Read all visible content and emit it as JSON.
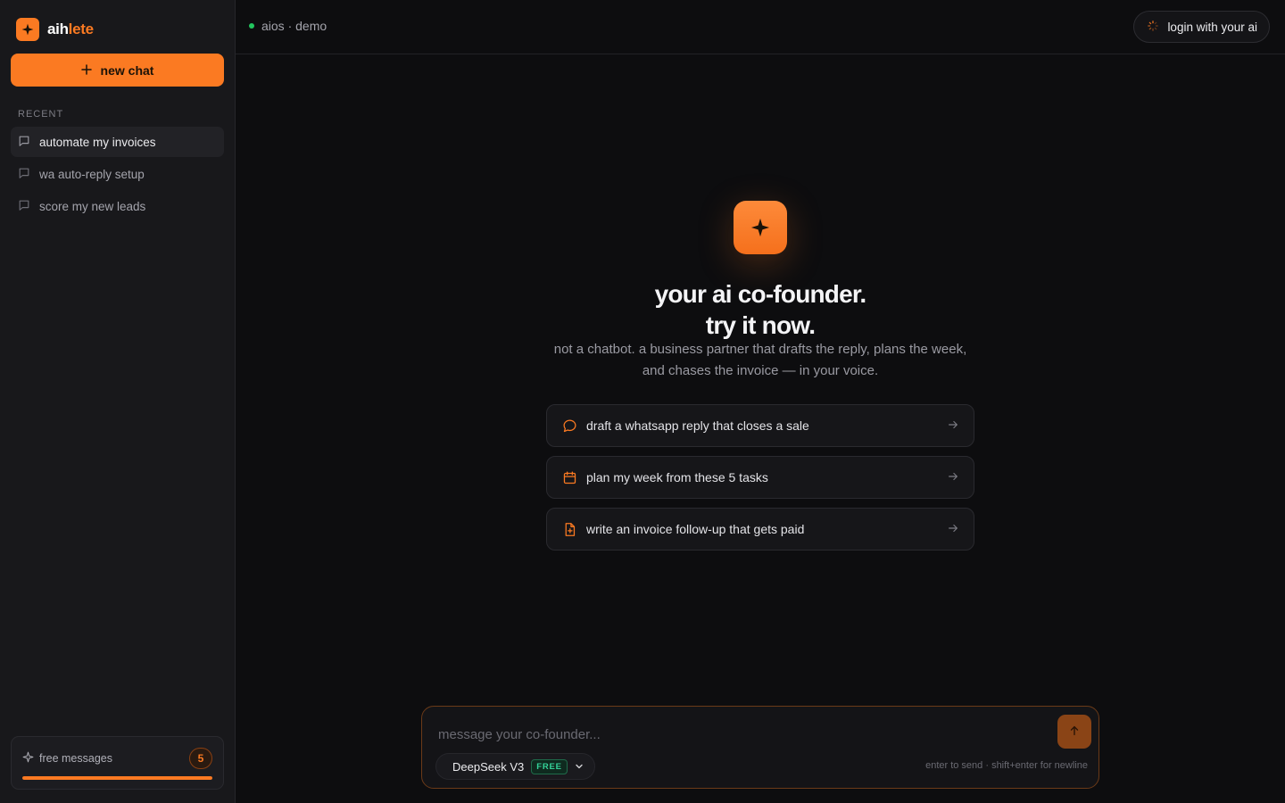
{
  "brand": {
    "name_part1": "aih",
    "name_part2": "lete",
    "logo_icon": "sparkle-icon",
    "accent": "#fb7a22"
  },
  "sidebar": {
    "new_chat_label": "new chat",
    "recent_label": "RECENT",
    "recent_items": [
      {
        "label": "automate my invoices",
        "active": true
      },
      {
        "label": "wa auto-reply setup",
        "active": false
      },
      {
        "label": "score my new leads",
        "active": false
      }
    ],
    "free_messages": {
      "label": "free messages",
      "count": "5",
      "progress": 1.0
    }
  },
  "topbar": {
    "status_text": "aios · demo",
    "status_color": "#22c55e",
    "login_label": "login with your ai"
  },
  "hero": {
    "title_line1": "your ai co-founder.",
    "title_line2": "try it now.",
    "subtitle": "not a chatbot. a business partner that drafts the reply, plans the week, and chases the invoice — in your voice."
  },
  "suggestions": [
    {
      "label": "draft a whatsapp reply that closes a sale",
      "icon": "message-icon"
    },
    {
      "label": "plan my week from these 5 tasks",
      "icon": "calendar-icon"
    },
    {
      "label": "write an invoice follow-up that gets paid",
      "icon": "file-plus-icon"
    }
  ],
  "composer": {
    "placeholder": "message your co-founder...",
    "value": "",
    "model_name": "DeepSeek V3",
    "model_tag": "FREE",
    "hint": "enter to send · shift+enter for newline"
  }
}
